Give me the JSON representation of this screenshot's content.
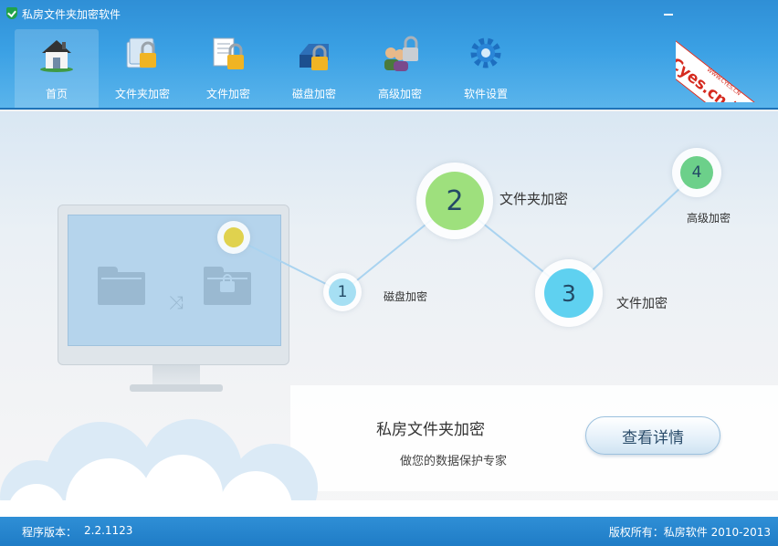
{
  "window": {
    "title": "私房文件夹加密软件"
  },
  "watermark": {
    "text": "Cyes.cn 资源港",
    "small": "WWW.CYES.CN"
  },
  "nav": {
    "items": [
      {
        "label": "首页",
        "icon": "home-icon",
        "active": true
      },
      {
        "label": "文件夹加密",
        "icon": "folder-lock-icon",
        "active": false
      },
      {
        "label": "文件加密",
        "icon": "file-lock-icon",
        "active": false
      },
      {
        "label": "磁盘加密",
        "icon": "disk-lock-icon",
        "active": false
      },
      {
        "label": "高级加密",
        "icon": "users-lock-icon",
        "active": false
      },
      {
        "label": "软件设置",
        "icon": "gear-icon",
        "active": false
      }
    ]
  },
  "steps": [
    {
      "number": "1",
      "label": "磁盘加密"
    },
    {
      "number": "2",
      "label": "文件夹加密"
    },
    {
      "number": "3",
      "label": "文件加密"
    },
    {
      "number": "4",
      "label": "高级加密"
    }
  ],
  "banner": {
    "title": "私房文件夹加密",
    "subtitle": "做您的数据保护专家",
    "button_label": "查看详情"
  },
  "status": {
    "version_label": "程序版本：",
    "version": "2.2.1123",
    "copyright": "版权所有：私房软件 2010-2013"
  },
  "colors": {
    "header": "#3aa0e4",
    "node1": "#a6dff3",
    "node2": "#9ee07d",
    "node3": "#5fd1f0",
    "node4": "#6cd08a",
    "start_dot": "#e0d24e",
    "ribbon": "#d52a1f"
  }
}
